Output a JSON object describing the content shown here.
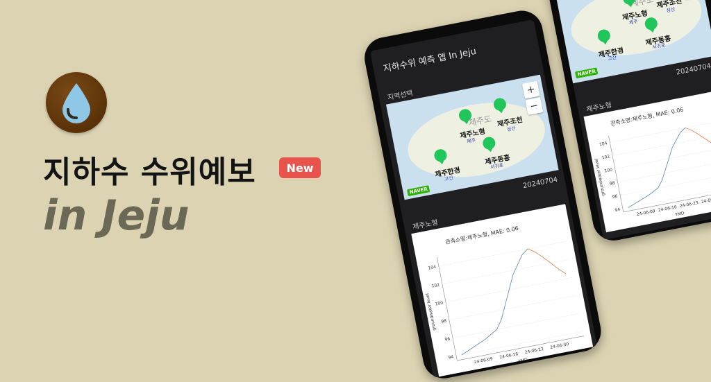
{
  "hero": {
    "title": "지하수 수위예보",
    "badge": "New",
    "subtitle": "in Jeju",
    "badge_color": "#e8534c",
    "bg": "#dcd3b2",
    "icon": "water-drop-icon"
  },
  "app": {
    "title": "지하수위 예측 앱 In Jeju",
    "region_label": "지역선택",
    "map": {
      "island": "제주도",
      "zoom_in": "+",
      "zoom_out": "−",
      "naver": "NAVER",
      "stations": [
        {
          "name": "제주노형",
          "sub": "제주"
        },
        {
          "name": "제주조천",
          "sub": "성산"
        },
        {
          "name": "제주한경",
          "sub": "고산"
        },
        {
          "name": "제주동홍",
          "sub": "서귀포"
        }
      ]
    },
    "date": "20240704",
    "selected_station": "제주노형",
    "chart_title": "관측소명:제주노형, MAE: 0.06"
  },
  "chart_data": {
    "type": "line",
    "title": "관측소명:제주노형, MAE: 0.06",
    "xlabel": "YMD",
    "ylabel": "groundwater level",
    "x_ticks": [
      "24-06-09",
      "24-06-16",
      "24-06-23",
      "24-06-30"
    ],
    "y_ticks": [
      94,
      96,
      98,
      100,
      102,
      104
    ],
    "ylim": [
      93.5,
      105
    ],
    "series": [
      {
        "name": "",
        "color": "#6d8fb0",
        "values": [
          94,
          94.3,
          94.6,
          94.9,
          95.2,
          95.6,
          96,
          97,
          98.5,
          100,
          101.5,
          102.5,
          103.5,
          104
        ]
      },
      {
        "name": "",
        "color": "#e08a58",
        "values": [
          104,
          103.5,
          102.8,
          102,
          101.2,
          100.5
        ]
      }
    ]
  }
}
